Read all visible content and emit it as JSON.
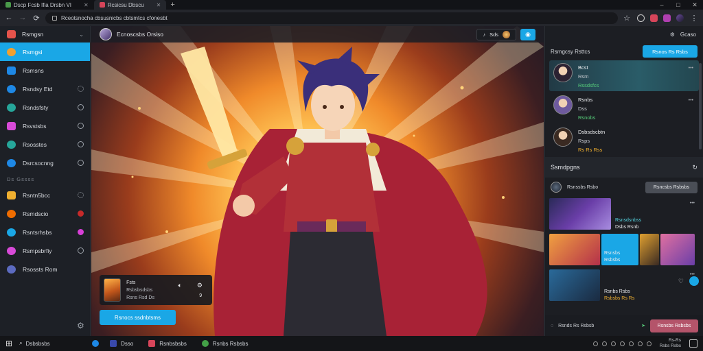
{
  "browser": {
    "tabs": [
      {
        "label": "Dscp Fcsb Ifia Drsbn VI",
        "active": false,
        "color": "#4a9a4a"
      },
      {
        "label": "Rcsicsu Dbscu",
        "active": true,
        "color": "#d6455a"
      }
    ],
    "new_tab_glyph": "+",
    "url": "Rceotsnocha cbsusnicbs cbtsmtcs cfonesbt",
    "window_controls": [
      "–",
      "□",
      "✕"
    ]
  },
  "sidebar": {
    "header": {
      "label": "Rsmgsn"
    },
    "items": [
      {
        "label": "Rsmgsi",
        "active": true,
        "icon_color": "#f0a030",
        "trail": "none"
      },
      {
        "label": "Rsmsns",
        "active": false,
        "icon_color": "#1e88e5",
        "trail": "none"
      },
      {
        "label": "Rsndsy Etd",
        "active": false,
        "icon_color": "#1e88e5",
        "trail": "gear"
      },
      {
        "label": "Rsndsfsty",
        "active": false,
        "icon_color": "#26a69a",
        "trail": "ring"
      },
      {
        "label": "Rsvstsbs",
        "active": false,
        "icon_color": "#d84ad8",
        "trail": "ring"
      },
      {
        "label": "Rsosstes",
        "active": false,
        "icon_color": "#26a69a",
        "trail": "ring"
      },
      {
        "label": "Dsrcsocnng",
        "active": false,
        "icon_color": "#1e88e5",
        "trail": "ring"
      }
    ],
    "section_label": "Ds Gssss",
    "items2": [
      {
        "label": "Rsntn5bcc",
        "icon_color": "#f0b030",
        "trail": "gear"
      },
      {
        "label": "Rsmdscio",
        "icon_color": "#ef6c00",
        "trail": "red"
      },
      {
        "label": "Rsntsrhsbs",
        "icon_color": "#1aa7e6",
        "trail": "pink"
      },
      {
        "label": "Rsmpsbrfiy",
        "icon_color": "#d84ad8",
        "trail": "ring"
      },
      {
        "label": "Rsossts Rom",
        "icon_color": "#5c6bc0",
        "trail": "none"
      }
    ]
  },
  "stage": {
    "header_title": "Ecnoscsbs Orsiso",
    "pill_text": "Sds",
    "now_playing": {
      "title": "Fsts",
      "line2": "Rsbsbsdsbs",
      "line3": "Rsns Rsd Ds",
      "page": "9"
    },
    "cta_label": "Rsnocs ssdnbtsms"
  },
  "right_panel": {
    "top_label": "Gcaso",
    "friends_title": "Rsmgcsy Rsttcs",
    "add_button": "Rsnos Rs Rsbs",
    "friends": [
      {
        "name": "Bcst",
        "sub": "Rsm",
        "status": "Rssdsfcs",
        "highlight": true
      },
      {
        "name": "Rsnbs",
        "sub": "Dss",
        "status": "Rsnobs",
        "highlight": false
      },
      {
        "name": "Dsbsdscbtn",
        "sub": "Rsps",
        "status": "Rs Rs Rss",
        "highlight": false
      }
    ],
    "more_glyph": "•••",
    "section_title": "Ssmdpgns",
    "group": {
      "name": "Rsnssbs Rsbo",
      "join_label": "Rsncsbs Rsbsbs"
    },
    "media": [
      {
        "caption": "Rsnsdsnbss",
        "sub": "Dsbs Rsnb"
      },
      {
        "caption": "Rsnsbs",
        "sub": "Rsbsbs"
      },
      {
        "caption": "Rsnbs Rsbs",
        "sub": "Rsbsbs Rs Rs"
      }
    ],
    "footer_label": "Rsnds Rs Rsbsb",
    "footer_action": "Rsnsbs Rsbsbs"
  },
  "taskbar": {
    "search_label": "Dsbsbsbs",
    "apps": [
      {
        "label": "Dsso",
        "color": "#3949ab"
      },
      {
        "label": "Rsnbsbsbs",
        "color": "#d6455a"
      },
      {
        "label": "Rsnbs Rsbsbs",
        "color": "#43a047"
      }
    ],
    "clock_time": "Rs-Rs",
    "clock_date": "Rsbs Rsbs"
  },
  "colors": {
    "accent": "#1aa7e6",
    "online": "#58d07c",
    "danger_action": "#b4546a"
  }
}
